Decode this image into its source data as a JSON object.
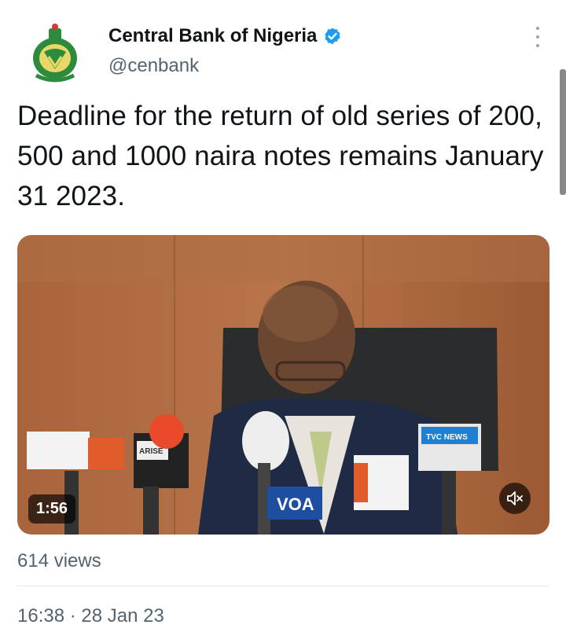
{
  "author": {
    "display_name": "Central Bank of Nigeria",
    "handle": "@cenbank",
    "verified": true
  },
  "tweet": {
    "text": "Deadline for the return of old series of 200, 500 and 1000 naira notes remains January 31 2023."
  },
  "media": {
    "duration": "1:56",
    "muted": true,
    "mic_labels": [
      "ARISE NEWS",
      "VOA",
      "TVC NEWS"
    ]
  },
  "stats": {
    "views": "614 views"
  },
  "meta": {
    "timestamp": "16:38 · 28 Jan 23"
  },
  "colors": {
    "text": "#0f1419",
    "secondary": "#536471",
    "verified": "#1d9bf0",
    "logo_green": "#2e8b3d"
  }
}
